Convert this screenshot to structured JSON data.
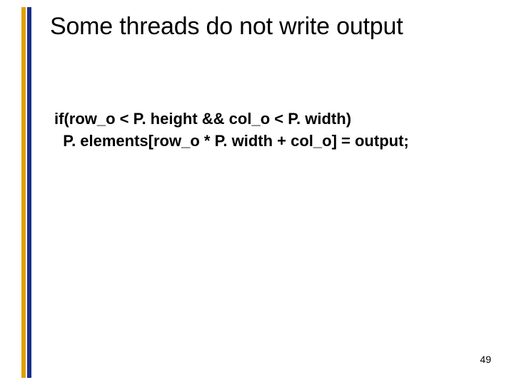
{
  "title": "Some threads do not write output",
  "code": {
    "line1": "if(row_o < P. height && col_o < P. width)",
    "line2": "  P. elements[row_o * P. width + col_o] = output;"
  },
  "page_number": "49"
}
